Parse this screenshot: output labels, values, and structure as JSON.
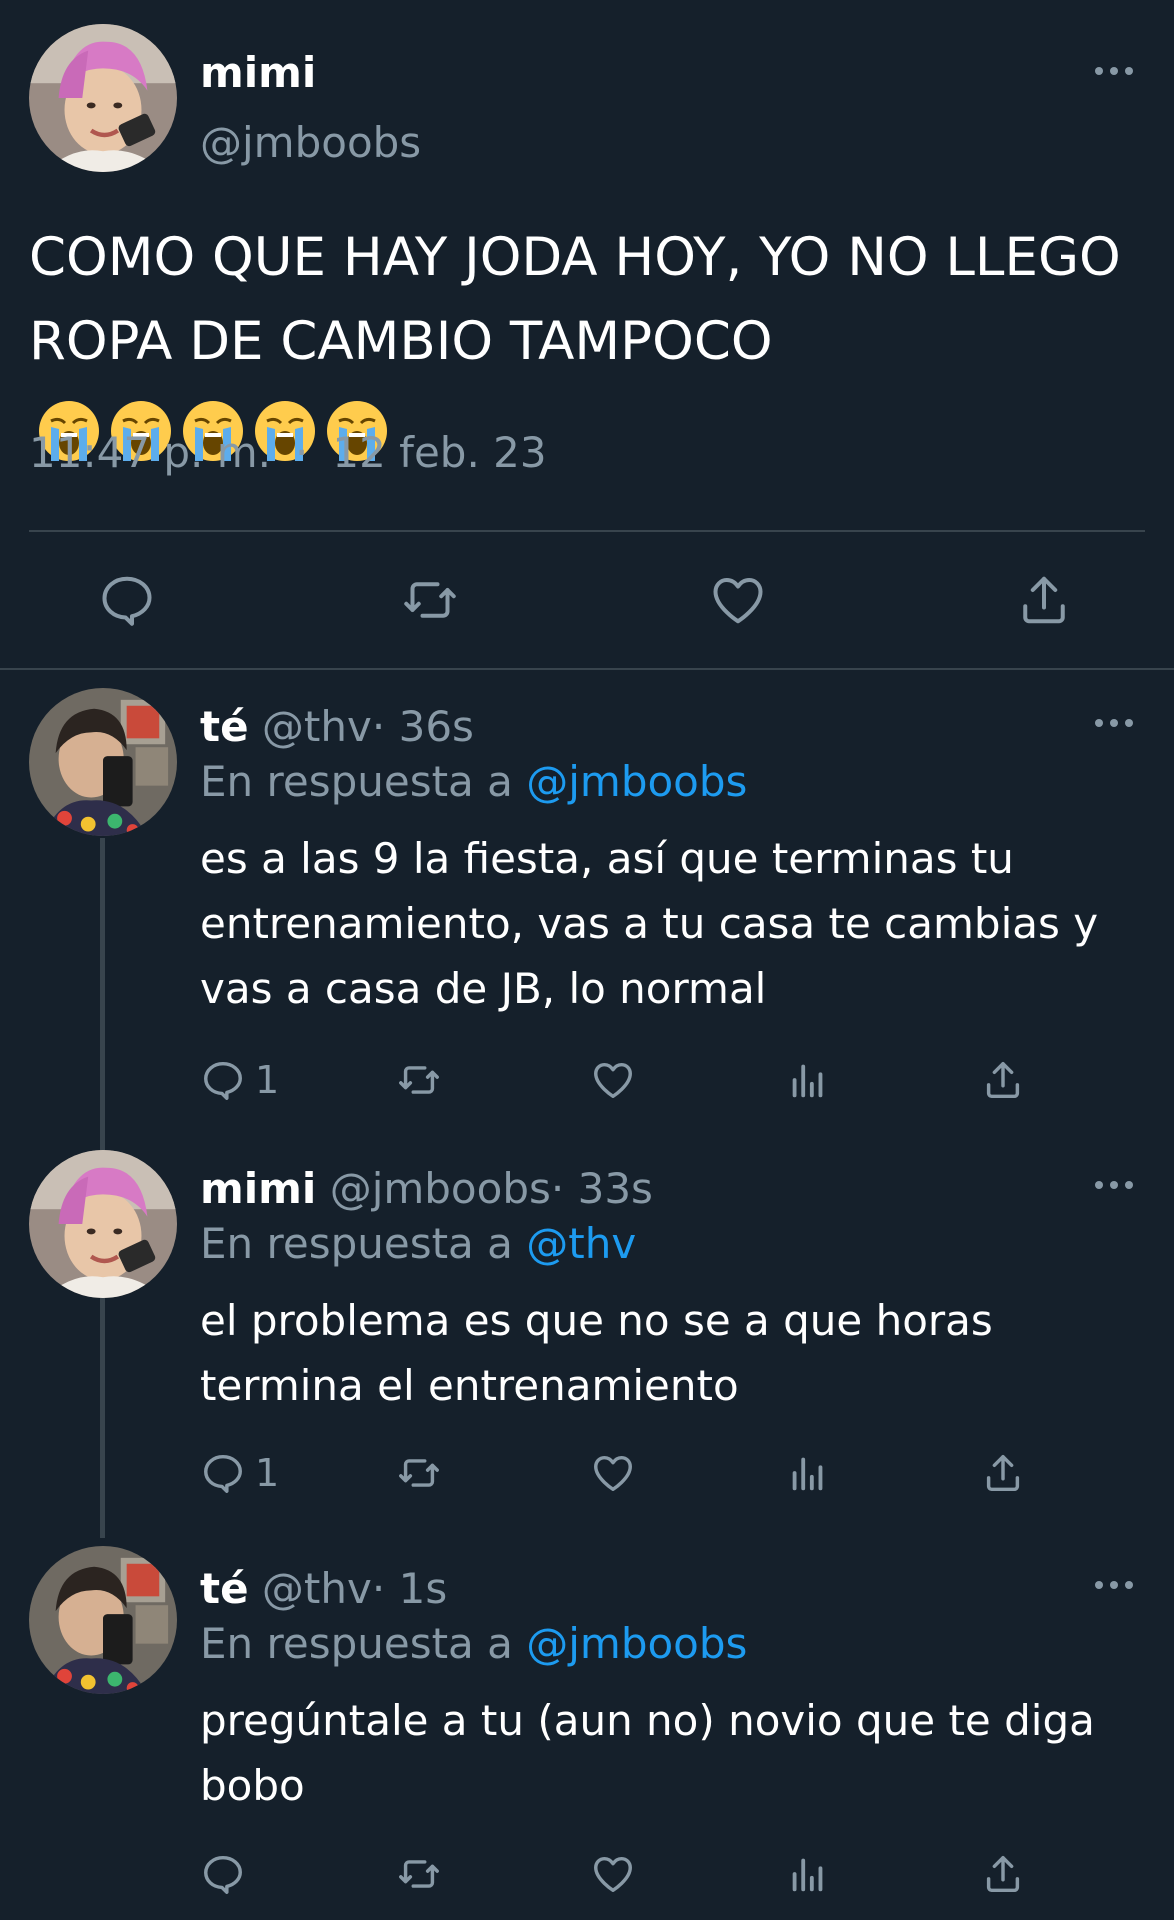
{
  "main_tweet": {
    "display_name": "mimi",
    "handle": "@jmboobs",
    "text": "COMO QUE HAY JODA HOY, YO NO LLEGO ROPA DE CAMBIO TAMPOCO",
    "emojis": [
      "loudly-crying-face",
      "loudly-crying-face",
      "loudly-crying-face",
      "loudly-crying-face",
      "loudly-crying-face"
    ],
    "time": "11:47 p. m.",
    "separator": "·",
    "date": "12 feb. 23",
    "actions": [
      "reply-icon",
      "retweet-icon",
      "like-icon",
      "share-icon"
    ]
  },
  "replies": [
    {
      "display_name": "té",
      "handle": "@thv",
      "separator": "·",
      "time": "36s",
      "replying_prefix": "En respuesta a",
      "replying_to": "@jmboobs",
      "text": "es a las 9 la fiesta, así que terminas tu entrenamiento, vas a tu casa te cambias y vas a casa de JB, lo normal",
      "reply_count": "1"
    },
    {
      "display_name": "mimi",
      "handle": "@jmboobs",
      "separator": "·",
      "time": "33s",
      "replying_prefix": "En respuesta a",
      "replying_to": "@thv",
      "text": "el problema es que no se a que horas termina el entrenamiento",
      "reply_count": "1"
    },
    {
      "display_name": "té",
      "handle": "@thv",
      "separator": "·",
      "time": "1s",
      "replying_prefix": "En respuesta a",
      "replying_to": "@jmboobs",
      "text": "pregúntale a tu (aun no) novio que te diga bobo",
      "reply_count": ""
    }
  ],
  "colors": {
    "background": "#15202b",
    "text": "#ffffff",
    "secondary": "#8899a6",
    "mention": "#1d9bf0",
    "divider": "#38444d"
  }
}
